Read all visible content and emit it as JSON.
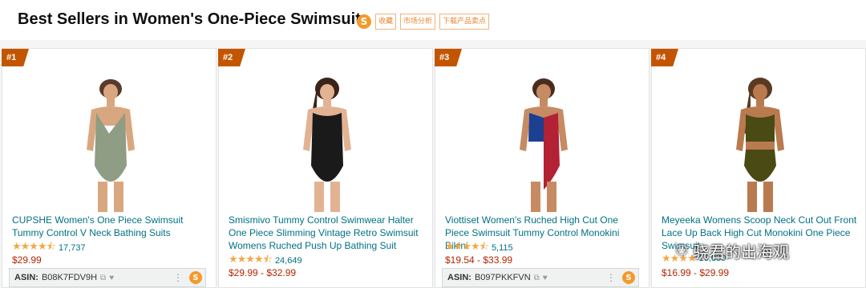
{
  "header": {
    "title": "Best Sellers in Women's One-Piece Swimsuits",
    "logo_letter": "S",
    "tools": [
      "收藏",
      "市场分析",
      "下载产品卖点"
    ]
  },
  "products": [
    {
      "rank": "#1",
      "title": "CUPSHE Women's One Piece Swimsuit Tummy Control V Neck Bathing Suits",
      "stars": "★★★★⯪",
      "rating_count": "17,737",
      "price": "$29.99",
      "asin_label": "ASIN:",
      "asin": "B08K7FDV9H",
      "swimsuit_color": "#8e9d84"
    },
    {
      "rank": "#2",
      "title": "Smismivo Tummy Control Swimwear Halter One Piece Slimming Vintage Retro Swimsuit Womens Ruched Push Up Bathing Suit",
      "stars": "★★★★⯪",
      "rating_count": "24,649",
      "price": "$29.99 - $32.99",
      "swimsuit_color": "#1a1a1a"
    },
    {
      "rank": "#3",
      "title": "Viottiset Women's Ruched High Cut One Piece Swimsuit Tummy Control Monokini Bikini",
      "stars": "★★★★⯪",
      "rating_count": "5,115",
      "price": "$19.54 - $33.99",
      "asin_label": "ASIN:",
      "asin": "B097PKKFVN",
      "swimsuit_color": "#b22234"
    },
    {
      "rank": "#4",
      "title": "Meyeeka Womens Scoop Neck Cut Out Front Lace Up Back High Cut Monokini One Piece Swimsuit",
      "stars": "★★★★",
      "rating_count": "16,030",
      "price": "$16.99 - $29.99",
      "swimsuit_color": "#4a4a14"
    }
  ],
  "watermark": {
    "text": "骁君的出海观"
  }
}
